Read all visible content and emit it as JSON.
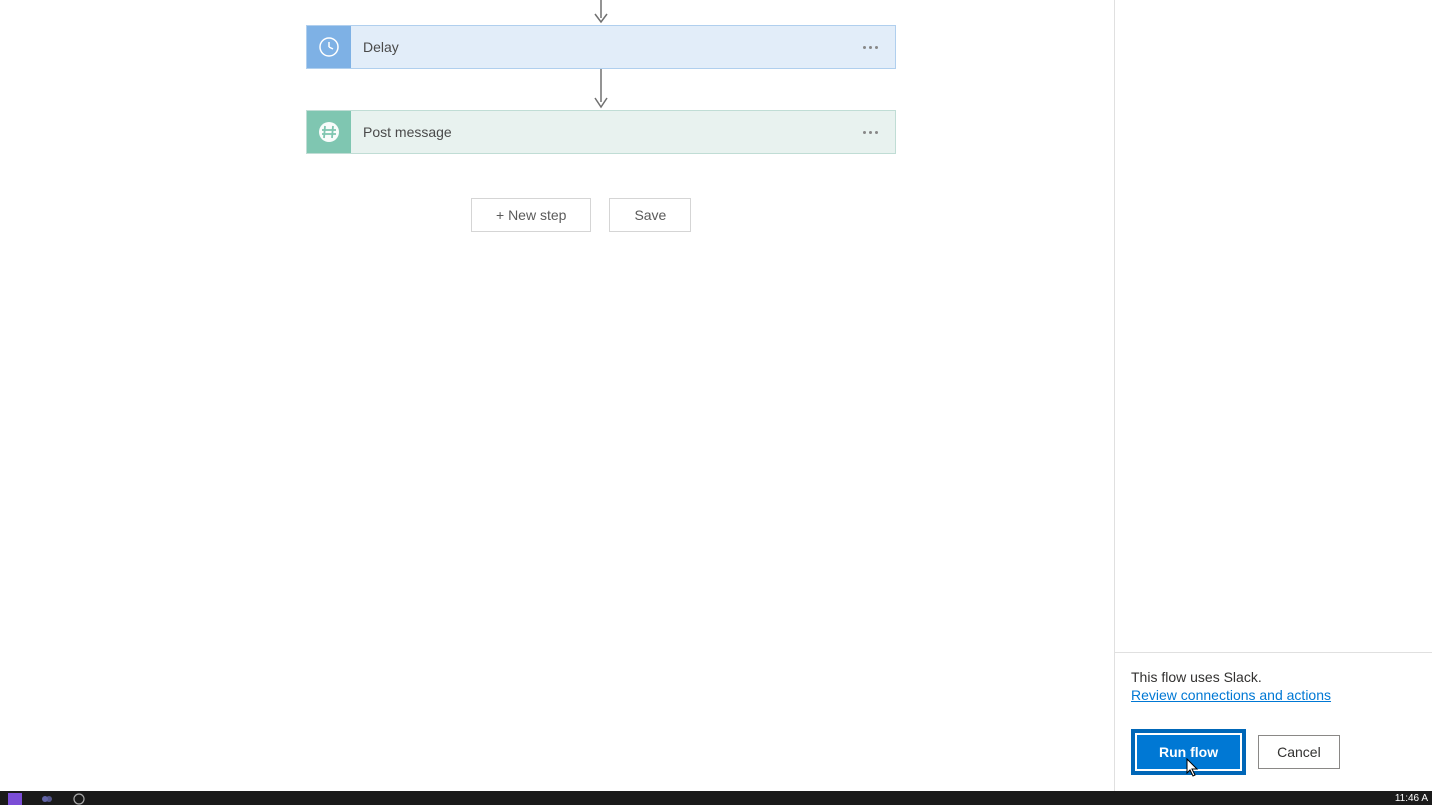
{
  "flow": {
    "steps": [
      {
        "label": "Delay",
        "icon": "clock-icon"
      },
      {
        "label": "Post message",
        "icon": "hash-icon"
      }
    ],
    "buttons": {
      "new_step": "+ New step",
      "save": "Save"
    }
  },
  "panel": {
    "info_text": "This flow uses Slack.",
    "review_link": "Review connections and actions",
    "run_button": "Run flow",
    "cancel_button": "Cancel"
  },
  "taskbar": {
    "time": "11:46 A"
  },
  "colors": {
    "primary": "#0078d4",
    "delay_bg": "#e2edf9",
    "delay_icon": "#7eb1e5",
    "post_bg": "#e8f2ef",
    "post_icon": "#7fc6b1"
  }
}
